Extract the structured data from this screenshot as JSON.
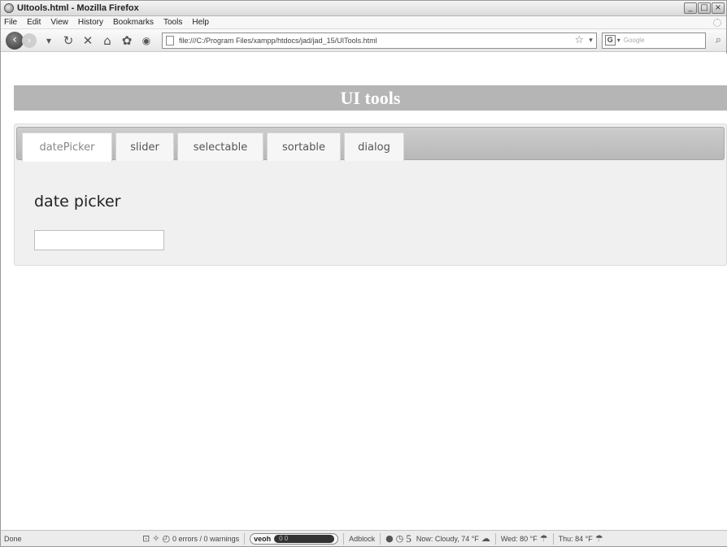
{
  "window": {
    "title": "UItools.html - Mozilla Firefox",
    "controls": [
      "minimize-icon",
      "maximize-icon",
      "close-icon"
    ]
  },
  "menu": {
    "items": [
      "File",
      "Edit",
      "View",
      "History",
      "Bookmarks",
      "Tools",
      "Help"
    ]
  },
  "nav": {
    "url": "file:///C:/Program Files/xampp/htdocs/jad/jad_15/UITools.html",
    "search_placeholder": "Google",
    "search_engine_letter": "G"
  },
  "page": {
    "header_title": "UI tools",
    "tabs": [
      {
        "label": "datePicker",
        "active": true
      },
      {
        "label": "slider",
        "active": false
      },
      {
        "label": "selectable",
        "active": false
      },
      {
        "label": "sortable",
        "active": false
      },
      {
        "label": "dialog",
        "active": false
      }
    ],
    "panel_heading": "date picker",
    "date_input_value": ""
  },
  "status": {
    "left": "Done",
    "errors": "0 errors / 0 warnings",
    "veoh_label": "veoh",
    "veoh_counts": "0  0",
    "adblock": "Adblock",
    "counter": "5",
    "weather_now": "Now: Cloudy, 74 °F",
    "weather_wed": "Wed: 80 °F",
    "weather_thu": "Thu: 84 °F"
  },
  "colors": {
    "header_bg": "#b5b5b5",
    "tab_bar_bg": "#c4c4c4",
    "panel_bg": "#f0f0f0"
  }
}
